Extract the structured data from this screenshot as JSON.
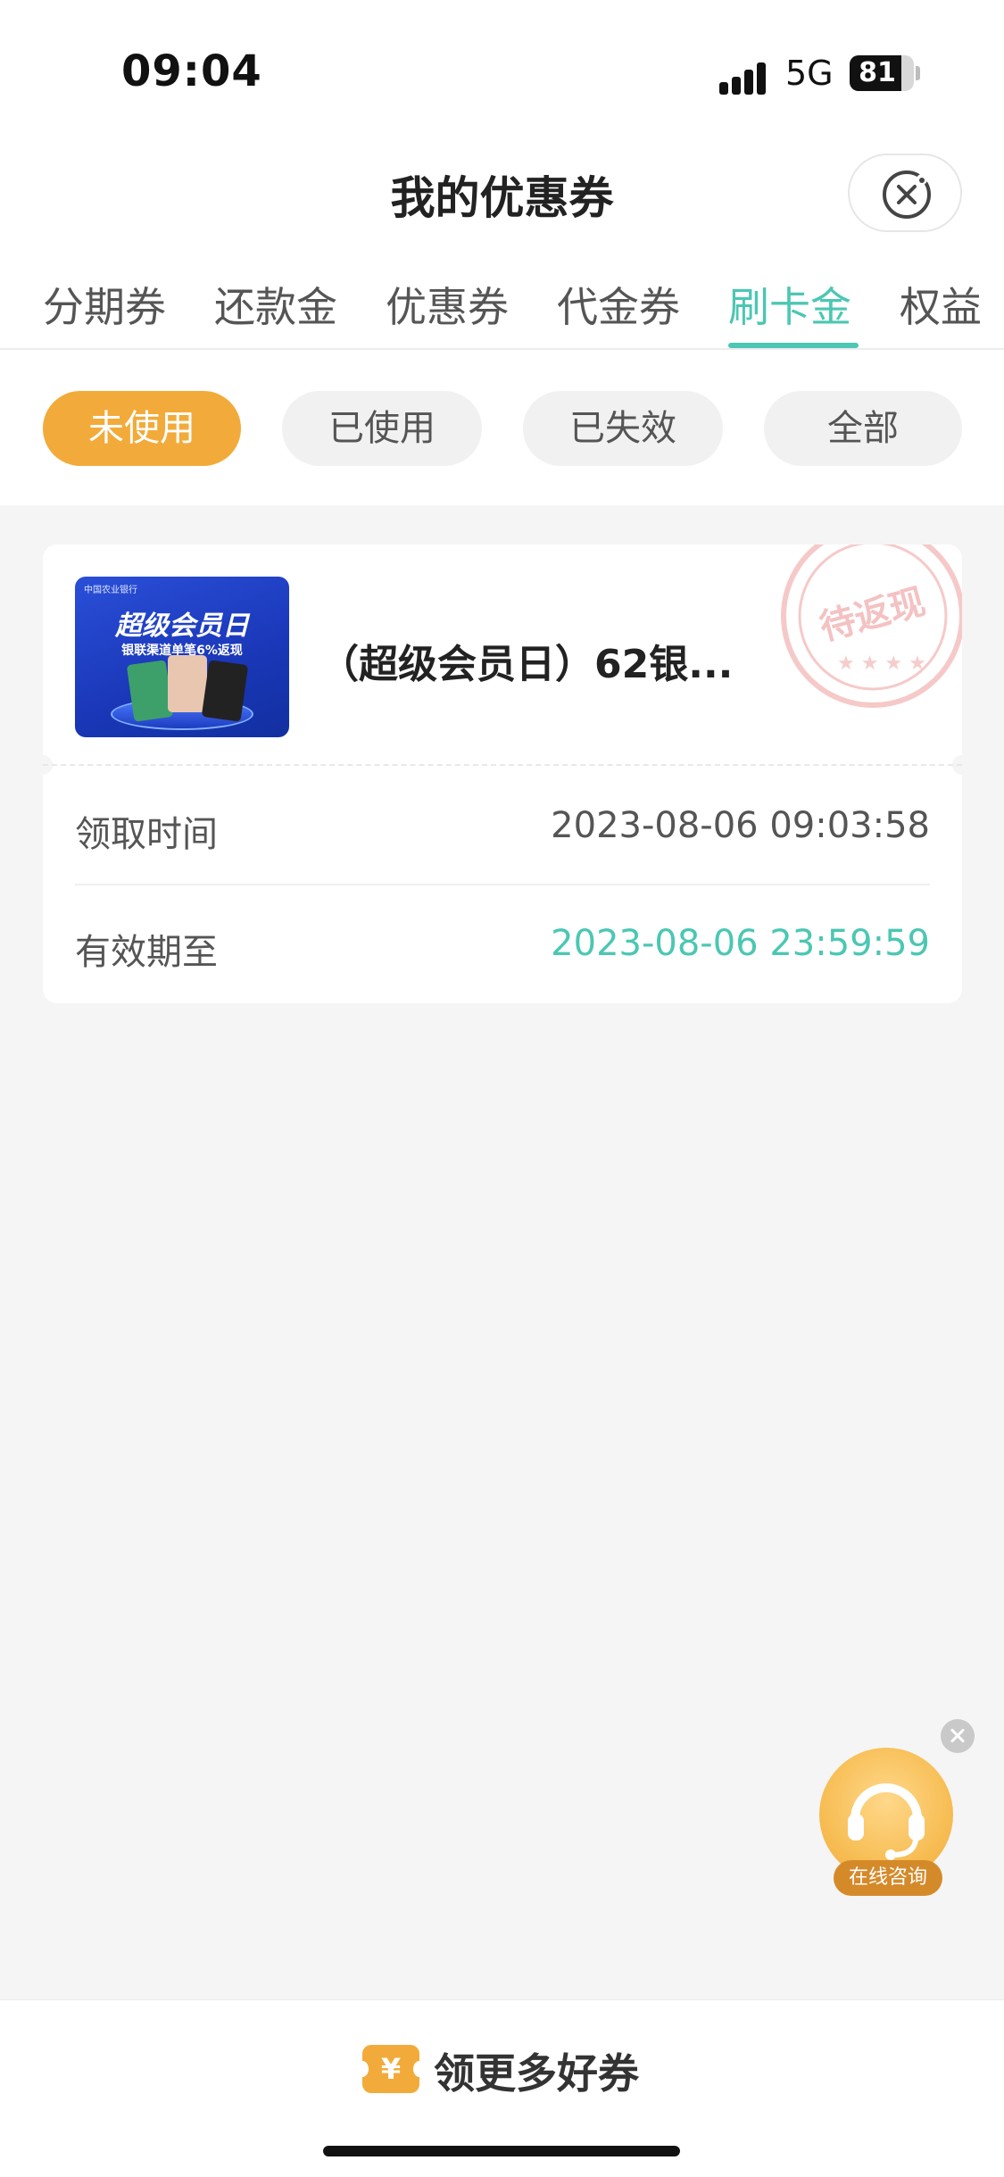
{
  "status_bar": {
    "time": "09:04",
    "network": "5G",
    "battery": "81",
    "battery_level": 0.81
  },
  "header": {
    "title": "我的优惠券"
  },
  "tabs": [
    {
      "label": "分期券",
      "active": false
    },
    {
      "label": "还款金",
      "active": false
    },
    {
      "label": "优惠券",
      "active": false
    },
    {
      "label": "代金券",
      "active": false
    },
    {
      "label": "刷卡金",
      "active": true
    },
    {
      "label": "权益",
      "active": false
    }
  ],
  "filters": [
    {
      "label": "未使用",
      "active": true
    },
    {
      "label": "已使用",
      "active": false
    },
    {
      "label": "已失效",
      "active": false
    },
    {
      "label": "全部",
      "active": false
    }
  ],
  "coupon": {
    "thumbnail": {
      "bank": "中国农业银行",
      "title": "超级会员日",
      "subtitle": "银联渠道单笔6%返现"
    },
    "title": "（超级会员日）62银...",
    "stamp": "待返现",
    "received_label": "领取时间",
    "received_value": "2023-08-06 09:03:58",
    "expire_label": "有效期至",
    "expire_value": "2023-08-06 23:59:59"
  },
  "float_service": {
    "label": "在线咨询",
    "icon": "headset-icon"
  },
  "bottom": {
    "icon_symbol": "¥",
    "label": "领更多好券"
  },
  "colors": {
    "accent": "#4bc7b3",
    "orange": "#f2ab3a",
    "background": "#f5f5f5"
  }
}
